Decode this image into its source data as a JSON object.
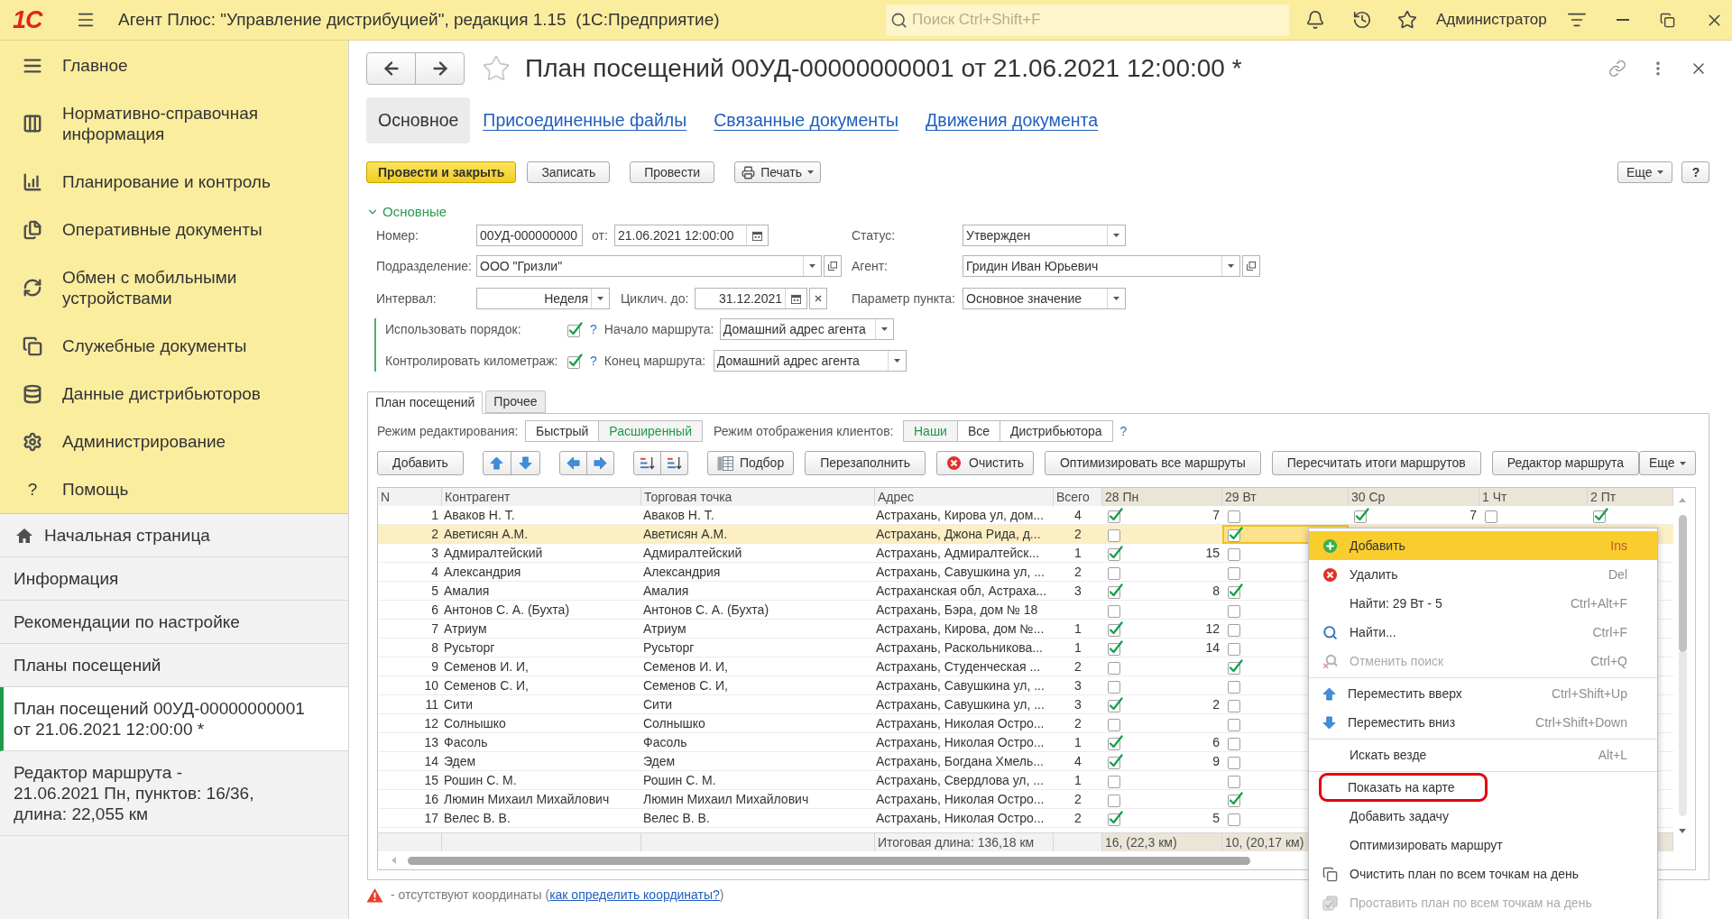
{
  "app_bar": {
    "logo": "1С",
    "title": "Агент Плюс: \"Управление дистрибуцией\", редакция 1.15  (1С:Предприятие)",
    "search": {
      "placeholder": "Поиск Ctrl+Shift+F"
    },
    "user": "Администратор"
  },
  "sections": [
    {
      "label": "Главное"
    },
    {
      "label": "Нормативно-справочная\nинформация"
    },
    {
      "label": "Планирование и контроль"
    },
    {
      "label": "Оперативные документы"
    },
    {
      "label": "Обмен с мобильными\nустройствами"
    },
    {
      "label": "Служебные документы"
    },
    {
      "label": "Данные дистрибьюторов"
    },
    {
      "label": "Администрирование"
    },
    {
      "label": "Помощь",
      "glyph": "?"
    }
  ],
  "open_windows": [
    {
      "kind": "home",
      "label": "Начальная страница",
      "selected": false
    },
    {
      "kind": "page",
      "label": "Информация",
      "selected": false
    },
    {
      "kind": "page",
      "label": "Рекомендации по настройке",
      "selected": false
    },
    {
      "kind": "page",
      "label": "Планы посещений",
      "selected": false
    },
    {
      "kind": "page",
      "label": "План посещений 00УД-00000000001\nот 21.06.2021 12:00:00 *",
      "selected": true
    },
    {
      "kind": "page",
      "label": "Редактор маршрута -\n21.06.2021 Пн, пунктов: 16/36,\nдлина: 22,055 км",
      "selected": false
    }
  ],
  "form": {
    "title": "План посещений 00УД-00000000001 от 21.06.2021 12:00:00 *",
    "favorite": false,
    "tabs": [
      {
        "label": "Основное",
        "selected": true
      },
      {
        "label": "Присоединенные файлы",
        "selected": false
      },
      {
        "label": "Связанные документы",
        "selected": false
      },
      {
        "label": "Движения документа",
        "selected": false
      }
    ],
    "commands": [
      {
        "kind": "primary",
        "label": "Провести и закрыть"
      },
      {
        "kind": "plain",
        "label": "Записать"
      },
      {
        "kind": "plain",
        "label": "Провести"
      },
      {
        "kind": "print",
        "label": "Печать"
      }
    ],
    "more": "Еще",
    "help": "?"
  },
  "main_group": {
    "title": "Основные",
    "expanded": true,
    "number": {
      "label": "Номер:",
      "value": "00УД-000000000"
    },
    "date": {
      "label": "от:",
      "value": "21.06.2021 12:00:00"
    },
    "status": {
      "label": "Статус:",
      "value": "Утвержден"
    },
    "department": {
      "label": "Подразделение:",
      "value": "ООО \"Гризли\""
    },
    "agent": {
      "label": "Агент:",
      "value": "Гридин Иван Юрьевич"
    },
    "interval": {
      "label": "Интервал:",
      "value": "Неделя"
    },
    "cycle_until": {
      "label": "Циклич. до:",
      "value": "31.12.2021"
    },
    "point_parameter": {
      "label": "Параметр пункта:",
      "value": "Основное значение"
    },
    "use_order": {
      "label": "Использовать порядок:",
      "checked": true,
      "hint": "?"
    },
    "route_start": {
      "label": "Начало маршрута:",
      "value": "Домашний адрес агента"
    },
    "control_mileage": {
      "label": "Контролировать километраж:",
      "checked": true,
      "hint": "?"
    },
    "route_end": {
      "label": "Конец маршрута:",
      "value": "Домашний адрес агента"
    }
  },
  "visit_plan": {
    "tabs": [
      {
        "label": "План посещений",
        "selected": true
      },
      {
        "label": "Прочее",
        "selected": false
      }
    ],
    "edit_mode": {
      "label": "Режим редактирования:",
      "options": [
        {
          "label": "Быстрый",
          "selected": false
        },
        {
          "label": "Расширенный",
          "selected": true
        }
      ]
    },
    "client_mode": {
      "label": "Режим отображения клиентов:",
      "options": [
        {
          "label": "Наши",
          "selected": true
        },
        {
          "label": "Все",
          "selected": false
        },
        {
          "label": "Дистрибьютора",
          "selected": false
        }
      ],
      "hint": "?"
    },
    "toolbar": [
      {
        "kind": "text",
        "label": "Добавить"
      },
      {
        "kind": "move_vertical"
      },
      {
        "kind": "move_horizontal"
      },
      {
        "kind": "sort"
      },
      {
        "kind": "pick",
        "label": "Подбор"
      },
      {
        "kind": "text",
        "label": "Перезаполнить"
      },
      {
        "kind": "clear",
        "label": "Очистить"
      },
      {
        "kind": "text",
        "label": "Оптимизировать все маршруты"
      },
      {
        "kind": "text",
        "label": "Пересчитать итоги маршрутов"
      },
      {
        "kind": "text",
        "label": "Редактор маршрута"
      },
      {
        "kind": "menu",
        "label": "Еще"
      }
    ],
    "table": {
      "columns": [
        "N",
        "Контрагент",
        "Торговая точка",
        "Адрес",
        "Всего"
      ],
      "day_columns": [
        "28 Пн",
        "29 Вт",
        "30 Ср",
        "1 Чт",
        "2 Пт"
      ],
      "rows": [
        {
          "n": "1",
          "counterparty": "Аваков Н. Т.",
          "outlet": "Аваков Н. Т.",
          "address": "Астрахань, Кирова ул, дом...",
          "total": "4",
          "selected": false,
          "days": [
            {
              "checked": true,
              "order": "7",
              "focused": false
            },
            {
              "checked": false,
              "focused": false
            },
            {
              "checked": true,
              "order": "7",
              "focused": false
            },
            {
              "checked": false,
              "focused": false
            },
            {
              "checked": true,
              "focused": false
            }
          ]
        },
        {
          "n": "2",
          "counterparty": "Аветисян А.М.",
          "outlet": "Аветисян А.М.",
          "address": "Астрахань, Джона Рида, д...",
          "total": "2",
          "selected": true,
          "days": [
            {
              "checked": false,
              "focused": false
            },
            {
              "checked": true,
              "focused": true
            }
          ]
        },
        {
          "n": "3",
          "counterparty": "Адмиралтейский",
          "outlet": "Адмиралтейский",
          "address": "Астрахань, Адмиралтейск...",
          "total": "1",
          "selected": false,
          "days": [
            {
              "checked": true,
              "order": "15",
              "focused": false
            },
            {
              "checked": false,
              "focused": false
            }
          ]
        },
        {
          "n": "4",
          "counterparty": "Александрия",
          "outlet": "Александрия",
          "address": "Астрахань, Савушкина ул, ...",
          "total": "2",
          "selected": false,
          "days": [
            {
              "checked": false,
              "focused": false
            },
            {
              "checked": false,
              "focused": false
            }
          ]
        },
        {
          "n": "5",
          "counterparty": "Амалия",
          "outlet": "Амалия",
          "address": "Астраханская обл, Астраха...",
          "total": "3",
          "selected": false,
          "days": [
            {
              "checked": true,
              "order": "8",
              "focused": false
            },
            {
              "checked": true,
              "focused": false
            }
          ]
        },
        {
          "n": "6",
          "counterparty": "Антонов С. А. (Бухта)",
          "outlet": "Антонов С. А. (Бухта)",
          "address": "Астрахань, Бэра, дом № 18",
          "selected": false,
          "days": [
            {
              "checked": false,
              "focused": false
            },
            {
              "checked": false,
              "focused": false
            }
          ]
        },
        {
          "n": "7",
          "counterparty": "Атриум",
          "outlet": "Атриум",
          "address": "Астрахань, Кирова, дом №...",
          "total": "1",
          "selected": false,
          "days": [
            {
              "checked": true,
              "order": "12",
              "focused": false
            },
            {
              "checked": false,
              "focused": false
            }
          ]
        },
        {
          "n": "8",
          "counterparty": "Русьторг",
          "outlet": "Русьторг",
          "address": "Астрахань, Раскольникова...",
          "total": "1",
          "selected": false,
          "days": [
            {
              "checked": true,
              "order": "14",
              "focused": false
            },
            {
              "checked": false,
              "focused": false
            }
          ]
        },
        {
          "n": "9",
          "counterparty": "Семенов И. И,",
          "outlet": "Семенов И. И,",
          "address": "Астрахань, Студенческая ...",
          "total": "2",
          "selected": false,
          "days": [
            {
              "checked": false,
              "focused": false
            },
            {
              "checked": true,
              "focused": false
            }
          ]
        },
        {
          "n": "10",
          "counterparty": "Семенов С. И,",
          "outlet": "Семенов С. И,",
          "address": "Астрахань, Савушкина ул, ...",
          "total": "3",
          "selected": false,
          "days": [
            {
              "checked": false,
              "focused": false
            },
            {
              "checked": false,
              "focused": false
            }
          ]
        },
        {
          "n": "11",
          "counterparty": "Сити",
          "outlet": "Сити",
          "address": "Астрахань, Савушкина ул, ...",
          "total": "3",
          "selected": false,
          "days": [
            {
              "checked": true,
              "order": "2",
              "focused": false
            },
            {
              "checked": false,
              "focused": false
            }
          ]
        },
        {
          "n": "12",
          "counterparty": "Солнышко",
          "outlet": "Солнышко",
          "address": "Астрахань, Николая Остро...",
          "total": "2",
          "selected": false,
          "days": [
            {
              "checked": false,
              "focused": false
            },
            {
              "checked": false,
              "focused": false
            }
          ]
        },
        {
          "n": "13",
          "counterparty": "Фасоль",
          "outlet": "Фасоль",
          "address": "Астрахань, Николая Остро...",
          "total": "1",
          "selected": false,
          "days": [
            {
              "checked": true,
              "order": "6",
              "focused": false
            },
            {
              "checked": false,
              "focused": false
            }
          ]
        },
        {
          "n": "14",
          "counterparty": "Эдем",
          "outlet": "Эдем",
          "address": "Астрахань, Богдана Хмель...",
          "total": "4",
          "selected": false,
          "days": [
            {
              "checked": true,
              "order": "9",
              "focused": false
            },
            {
              "checked": false,
              "focused": false
            }
          ]
        },
        {
          "n": "15",
          "counterparty": "Рошин С. М.",
          "outlet": "Рошин С. М.",
          "address": "Астрахань, Свердлова ул, ...",
          "total": "1",
          "selected": false,
          "days": [
            {
              "checked": false,
              "focused": false
            },
            {
              "checked": false,
              "focused": false
            }
          ]
        },
        {
          "n": "16",
          "counterparty": "Люмин Михаил Михайлович",
          "outlet": "Люмин Михаил Михайлович",
          "address": "Астрахань, Николая Остро...",
          "total": "2",
          "selected": false,
          "days": [
            {
              "checked": false,
              "focused": false
            },
            {
              "checked": true,
              "focused": false
            }
          ]
        },
        {
          "n": "17",
          "counterparty": "Велес В. В.",
          "outlet": "Велес В. В.",
          "address": "Астрахань, Николая Остро...",
          "total": "2",
          "selected": false,
          "days": [
            {
              "checked": true,
              "order": "5",
              "focused": false
            },
            {
              "checked": false,
              "focused": false
            }
          ]
        }
      ],
      "footer": {
        "address": "Итоговая длина: 136,18 км",
        "days": [
          "16, (22,3 км)",
          "10, (20,17 км)"
        ]
      }
    },
    "context_menu": {
      "items": [
        {
          "kind": "item",
          "label": "Добавить",
          "shortcut": "Ins",
          "selected": true,
          "disabled": false,
          "marked": false
        },
        {
          "kind": "item",
          "label": "Удалить",
          "shortcut": "Del",
          "selected": false,
          "disabled": false,
          "marked": false
        },
        {
          "kind": "item",
          "label": "Найти: 29 Вт - 5",
          "shortcut": "Ctrl+Alt+F",
          "selected": false,
          "disabled": false,
          "marked": false
        },
        {
          "kind": "item",
          "label": "Найти...",
          "shortcut": "Ctrl+F",
          "selected": false,
          "disabled": false,
          "marked": false
        },
        {
          "kind": "item",
          "label": "Отменить поиск",
          "shortcut": "Ctrl+Q",
          "selected": false,
          "disabled": true,
          "marked": false
        },
        {
          "kind": "separator"
        },
        {
          "kind": "item",
          "label": "Переместить вверх",
          "shortcut": "Ctrl+Shift+Up",
          "selected": false,
          "disabled": false,
          "marked": false
        },
        {
          "kind": "item",
          "label": "Переместить вниз",
          "shortcut": "Ctrl+Shift+Down",
          "selected": false,
          "disabled": false,
          "marked": false
        },
        {
          "kind": "separator"
        },
        {
          "kind": "item",
          "label": "Искать везде",
          "shortcut": "Alt+L",
          "selected": false,
          "disabled": false,
          "marked": false
        },
        {
          "kind": "separator"
        },
        {
          "kind": "item",
          "label": "Показать на карте",
          "selected": false,
          "disabled": false,
          "marked": true
        },
        {
          "kind": "item",
          "label": "Добавить задачу",
          "selected": false,
          "disabled": false,
          "marked": false
        },
        {
          "kind": "item",
          "label": "Оптимизировать маршрут",
          "selected": false,
          "disabled": false,
          "marked": false
        },
        {
          "kind": "item",
          "label": "Очистить план по всем точкам на день",
          "selected": false,
          "disabled": false,
          "marked": false
        },
        {
          "kind": "item",
          "label": "Проставить план по всем точкам на день",
          "selected": false,
          "disabled": true,
          "marked": false
        }
      ]
    }
  },
  "legend": {
    "text": "- отсутствуют координаты (",
    "link": "как определить координаты?",
    "after": ")"
  }
}
